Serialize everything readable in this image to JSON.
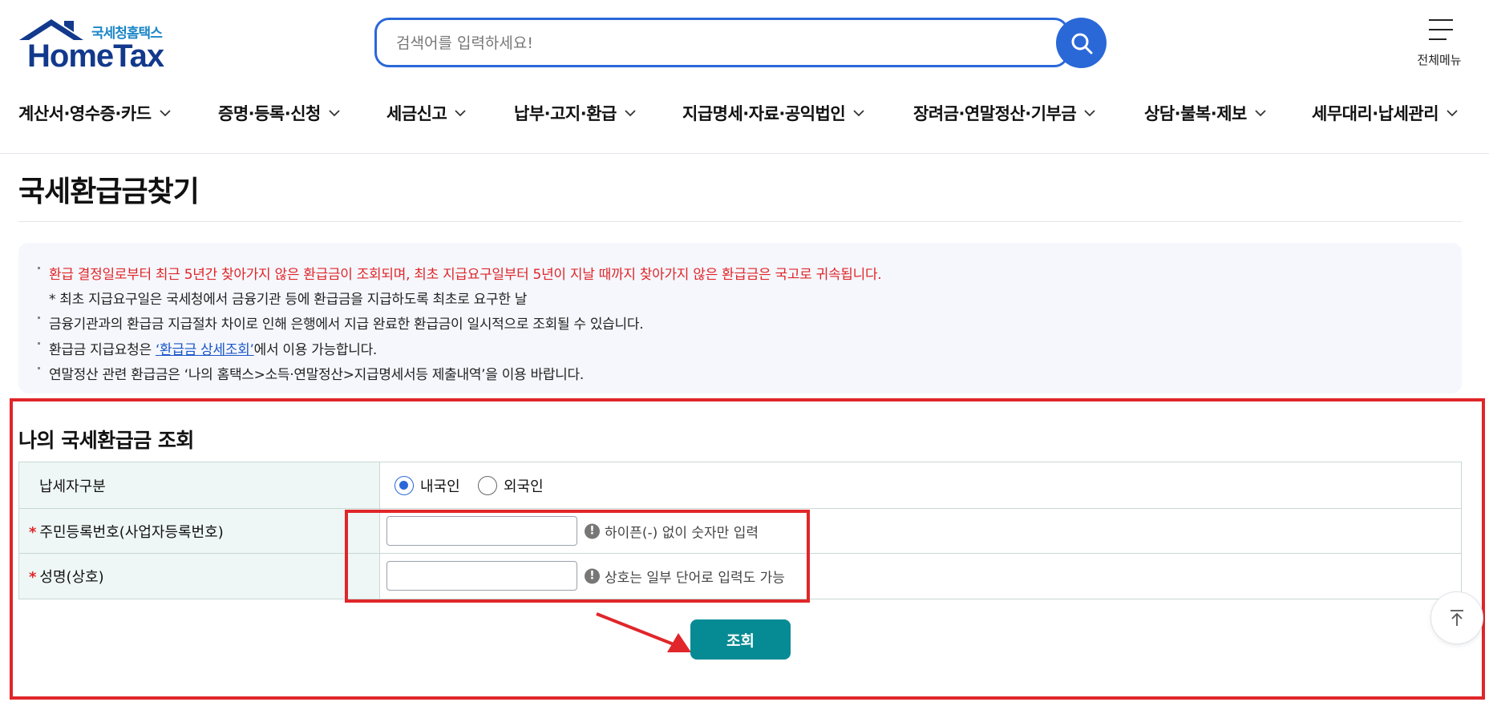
{
  "header": {
    "logo_sub": "국세청홈택스",
    "logo_main": "HomeTax",
    "search_placeholder": "검색어를 입력하세요!",
    "all_menu_label": "전체메뉴"
  },
  "nav": {
    "items": [
      "계산서·영수증·카드",
      "증명·등록·신청",
      "세금신고",
      "납부·고지·환급",
      "지급명세·자료·공익법인",
      "장려금·연말정산·기부금",
      "상담·불복·제보",
      "세무대리·납세관리"
    ]
  },
  "page": {
    "title": "국세환급금찾기"
  },
  "notice": {
    "line1": "환급 결정일로부터 최근 5년간 찾아가지 않은 환급금이 조회되며, 최초 지급요구일부터 5년이 지날 때까지 찾아가지 않은 환급금은 국고로 귀속됩니다.",
    "line1_sub": "* 최초 지급요구일은 국세청에서 금융기관 등에 환급금을 지급하도록 최초로 요구한 날",
    "line2": "금융기관과의 환급금 지급절차 차이로 인해 은행에서 지급 완료한 환급금이 일시적으로 조회될 수 있습니다.",
    "line3_prefix": "환급금 지급요청은 ",
    "line3_link": "‘환급금 상세조회’",
    "line3_suffix": "에서 이용 가능합니다.",
    "line4": "연말정산 관련 환급금은 ‘나의 홈택스>소득·연말정산>지급명세서등 제출내역’을 이용 바랍니다."
  },
  "form": {
    "section_title": "나의 국세환급금 조회",
    "taxpayer_type_label": "납세자구분",
    "option_domestic": "내국인",
    "option_foreign": "외국인",
    "selected": "내국인",
    "required_mark": "*",
    "id_label": "주민등록번호(사업자등록번호)",
    "id_value": "",
    "id_hint": "하이픈(-) 없이 숫자만 입력",
    "name_label": "성명(상호)",
    "name_value": "",
    "name_hint": "상호는 일부 단어로 입력도 가능",
    "hint_icon_glyph": "!",
    "submit_label": "조회"
  },
  "colors": {
    "brand_blue": "#2a68d8",
    "teal_button": "#068b94",
    "highlight_red": "#e0262a"
  }
}
